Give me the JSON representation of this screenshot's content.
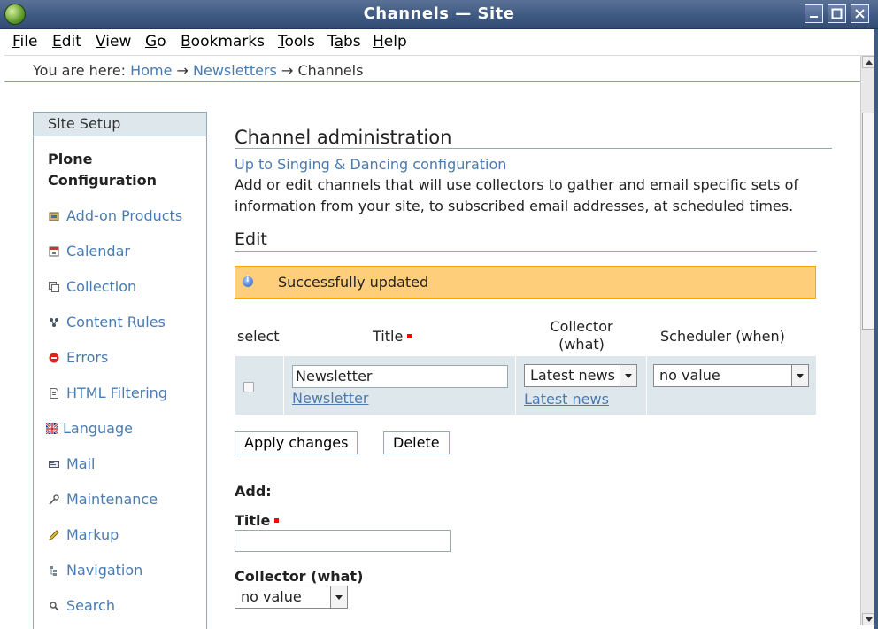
{
  "window": {
    "title": "Channels — Site"
  },
  "menu": [
    "File",
    "Edit",
    "View",
    "Go",
    "Bookmarks",
    "Tools",
    "Tabs",
    "Help"
  ],
  "breadcrumb": {
    "prefix": "You are here:",
    "home": "Home",
    "arrow": "→",
    "newsletters": "Newsletters",
    "current": "Channels"
  },
  "sidebar": {
    "header": "Site Setup",
    "subheading": "Plone Configuration",
    "items": [
      {
        "label": "Add-on Products",
        "icon": "product-icon"
      },
      {
        "label": "Calendar",
        "icon": "calendar-icon"
      },
      {
        "label": "Collection",
        "icon": "collection-icon"
      },
      {
        "label": "Content Rules",
        "icon": "content-rules-icon"
      },
      {
        "label": "Errors",
        "icon": "error-icon"
      },
      {
        "label": "HTML Filtering",
        "icon": "html-filter-icon"
      },
      {
        "label": "Language",
        "icon": "language-flag-icon"
      },
      {
        "label": "Mail",
        "icon": "mail-icon"
      },
      {
        "label": "Maintenance",
        "icon": "wrench-icon"
      },
      {
        "label": "Markup",
        "icon": "pencil-icon"
      },
      {
        "label": "Navigation",
        "icon": "navigation-icon"
      },
      {
        "label": "Search",
        "icon": "search-icon"
      }
    ]
  },
  "main": {
    "heading": "Channel administration",
    "up_link": "Up to Singing & Dancing configuration",
    "description": "Add or edit channels that will use collectors to gather and email specific sets of information from your site, to subscribed email addresses, at scheduled times.",
    "edit_heading": "Edit",
    "status_message": "Successfully updated",
    "table": {
      "headers": {
        "select": "select",
        "title": "Title",
        "collector": "Collector (what)",
        "scheduler": "Scheduler (when)"
      },
      "row": {
        "title_value": "Newsletter",
        "title_link": "Newsletter",
        "collector_value": "Latest news",
        "collector_link": "Latest news",
        "scheduler_value": "no value"
      }
    },
    "buttons": {
      "apply": "Apply changes",
      "delete": "Delete"
    },
    "add": {
      "heading": "Add:",
      "title_label": "Title",
      "title_value": "",
      "collector_label": "Collector (what)",
      "collector_value": "no value"
    }
  }
}
